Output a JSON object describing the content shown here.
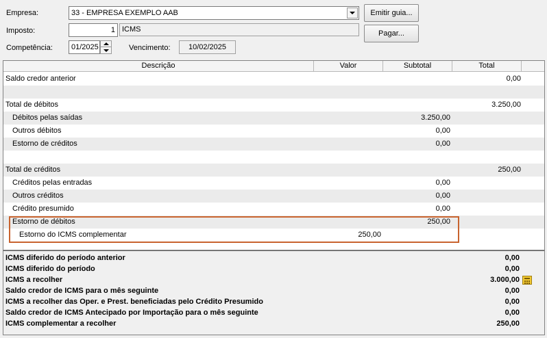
{
  "form": {
    "empresa_label": "Empresa:",
    "empresa_value": "33 - EMPRESA EXEMPLO AAB",
    "imposto_label": "Imposto:",
    "imposto_code": "1",
    "imposto_name": "ICMS",
    "competencia_label": "Competência:",
    "competencia_value": "01/2025",
    "vencimento_label": "Vencimento:",
    "vencimento_value": "10/02/2025",
    "emitir_button": "Emitir guia...",
    "pagar_button": "Pagar..."
  },
  "grid": {
    "columns": [
      "Descrição",
      "Valor",
      "Subtotal",
      "Total"
    ],
    "rows": [
      {
        "desc": "Saldo credor anterior",
        "level": 0,
        "valor": "",
        "subtotal": "",
        "total": "0,00"
      },
      {
        "desc": "",
        "level": 0,
        "valor": "",
        "subtotal": "",
        "total": ""
      },
      {
        "desc": "Total de débitos",
        "level": 0,
        "valor": "",
        "subtotal": "",
        "total": "3.250,00"
      },
      {
        "desc": "Débitos pelas saídas",
        "level": 1,
        "valor": "",
        "subtotal": "3.250,00",
        "total": ""
      },
      {
        "desc": "Outros débitos",
        "level": 1,
        "valor": "",
        "subtotal": "0,00",
        "total": ""
      },
      {
        "desc": "Estorno de créditos",
        "level": 1,
        "valor": "",
        "subtotal": "0,00",
        "total": ""
      },
      {
        "desc": "",
        "level": 0,
        "valor": "",
        "subtotal": "",
        "total": ""
      },
      {
        "desc": "Total de créditos",
        "level": 0,
        "valor": "",
        "subtotal": "",
        "total": "250,00"
      },
      {
        "desc": "Créditos pelas entradas",
        "level": 1,
        "valor": "",
        "subtotal": "0,00",
        "total": ""
      },
      {
        "desc": "Outros créditos",
        "level": 1,
        "valor": "",
        "subtotal": "0,00",
        "total": ""
      },
      {
        "desc": "Crédito presumido",
        "level": 1,
        "valor": "",
        "subtotal": "0,00",
        "total": ""
      },
      {
        "desc": "Estorno de débitos",
        "level": 1,
        "valor": "",
        "subtotal": "250,00",
        "total": ""
      },
      {
        "desc": "Estorno do ICMS complementar",
        "level": 2,
        "valor": "250,00",
        "subtotal": "",
        "total": ""
      }
    ]
  },
  "summary": {
    "rows": [
      {
        "label": "ICMS diferido do período anterior",
        "value": "0,00"
      },
      {
        "label": "ICMS diferido do período",
        "value": "0,00"
      },
      {
        "label": "ICMS a recolher",
        "value": "3.000,00"
      },
      {
        "label": "Saldo credor de ICMS para o mês seguinte",
        "value": "0,00"
      },
      {
        "label": "ICMS a recolher das Oper. e Prest. beneficiadas pelo Crédito Presumido",
        "value": "0,00"
      },
      {
        "label": "Saldo credor de ICMS Antecipado por Importação para o mês seguinte",
        "value": "0,00"
      },
      {
        "label": "ICMS complementar a recolher",
        "value": "250,00"
      }
    ]
  },
  "colors": {
    "highlight_border": "#c8632e",
    "calculator_icon": "#f2c933"
  },
  "icons": {
    "combo": "chevron-down-icon",
    "spin_up": "spin-up-icon",
    "spin_down": "spin-down-icon",
    "calculator": "calculator-icon"
  }
}
